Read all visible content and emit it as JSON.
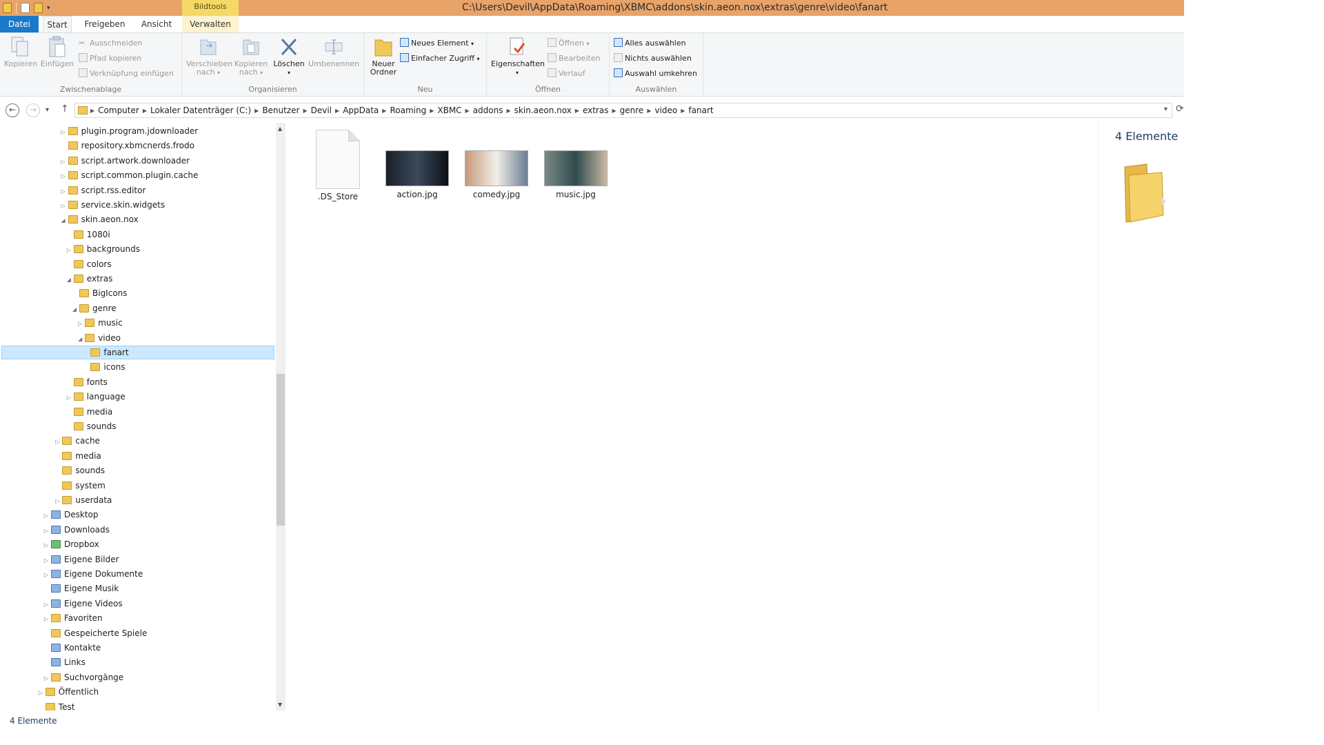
{
  "window": {
    "title": "C:\\Users\\Devil\\AppData\\Roaming\\XBMC\\addons\\skin.aeon.nox\\extras\\genre\\video\\fanart",
    "context_tab_label": "Bildtools"
  },
  "tabs": {
    "datei": "Datei",
    "start": "Start",
    "freigeben": "Freigeben",
    "ansicht": "Ansicht",
    "verwalten": "Verwalten"
  },
  "ribbon": {
    "zwischenablage": {
      "label": "Zwischenablage",
      "kopieren": "Kopieren",
      "einfuegen": "Einfügen",
      "ausschneiden": "Ausschneiden",
      "pfad_kopieren": "Pfad kopieren",
      "verknuepfung": "Verknüpfung einfügen"
    },
    "organisieren": {
      "label": "Organisieren",
      "verschieben_1": "Verschieben",
      "verschieben_2": "nach",
      "kopieren_1": "Kopieren",
      "kopieren_2": "nach",
      "loeschen": "Löschen",
      "umbenennen": "Umbenennen"
    },
    "neu": {
      "label": "Neu",
      "neuer_1": "Neuer",
      "neuer_2": "Ordner",
      "neues_element": "Neues Element",
      "einfacher_zugriff": "Einfacher Zugriff"
    },
    "oeffnen": {
      "label": "Öffnen",
      "eigenschaften": "Eigenschaften",
      "oeffnen": "Öffnen",
      "bearbeiten": "Bearbeiten",
      "verlauf": "Verlauf"
    },
    "auswaehlen": {
      "label": "Auswählen",
      "alles": "Alles auswählen",
      "nichts": "Nichts auswählen",
      "umkehren": "Auswahl umkehren"
    }
  },
  "breadcrumbs": [
    "Computer",
    "Lokaler Datenträger (C:)",
    "Benutzer",
    "Devil",
    "AppData",
    "Roaming",
    "XBMC",
    "addons",
    "skin.aeon.nox",
    "extras",
    "genre",
    "video",
    "fanart"
  ],
  "tree": [
    {
      "label": "plugin.program.jdownloader",
      "level": 3,
      "exp": "▷",
      "type": "folder"
    },
    {
      "label": "repository.xbmcnerds.frodo",
      "level": 3,
      "exp": "",
      "type": "folder"
    },
    {
      "label": "script.artwork.downloader",
      "level": 3,
      "exp": "▷",
      "type": "folder"
    },
    {
      "label": "script.common.plugin.cache",
      "level": 3,
      "exp": "▷",
      "type": "folder"
    },
    {
      "label": "script.rss.editor",
      "level": 3,
      "exp": "▷",
      "type": "folder"
    },
    {
      "label": "service.skin.widgets",
      "level": 3,
      "exp": "▷",
      "type": "folder"
    },
    {
      "label": "skin.aeon.nox",
      "level": 3,
      "exp": "◢",
      "type": "folder"
    },
    {
      "label": "1080i",
      "level": 4,
      "exp": "",
      "type": "folder"
    },
    {
      "label": "backgrounds",
      "level": 4,
      "exp": "▷",
      "type": "folder"
    },
    {
      "label": "colors",
      "level": 4,
      "exp": "",
      "type": "folder"
    },
    {
      "label": "extras",
      "level": 4,
      "exp": "◢",
      "type": "folder"
    },
    {
      "label": "BigIcons",
      "level": 5,
      "exp": "",
      "type": "folder"
    },
    {
      "label": "genre",
      "level": 5,
      "exp": "◢",
      "type": "folder"
    },
    {
      "label": "music",
      "level": 6,
      "exp": "▷",
      "type": "folder"
    },
    {
      "label": "video",
      "level": 6,
      "exp": "◢",
      "type": "folder"
    },
    {
      "label": "fanart",
      "level": 7,
      "exp": "",
      "type": "folder",
      "selected": true
    },
    {
      "label": "icons",
      "level": 7,
      "exp": "",
      "type": "folder"
    },
    {
      "label": "fonts",
      "level": 4,
      "exp": "",
      "type": "folder"
    },
    {
      "label": "language",
      "level": 4,
      "exp": "▷",
      "type": "folder"
    },
    {
      "label": "media",
      "level": 4,
      "exp": "",
      "type": "folder"
    },
    {
      "label": "sounds",
      "level": 4,
      "exp": "",
      "type": "folder"
    },
    {
      "label": "cache",
      "level": 2,
      "exp": "▷",
      "type": "folder"
    },
    {
      "label": "media",
      "level": 2,
      "exp": "",
      "type": "folder"
    },
    {
      "label": "sounds",
      "level": 2,
      "exp": "",
      "type": "folder"
    },
    {
      "label": "system",
      "level": 2,
      "exp": "",
      "type": "folder"
    },
    {
      "label": "userdata",
      "level": 2,
      "exp": "▷",
      "type": "folder"
    },
    {
      "label": "Desktop",
      "level": 0,
      "exp": "▷",
      "type": "lib"
    },
    {
      "label": "Downloads",
      "level": 0,
      "exp": "▷",
      "type": "lib"
    },
    {
      "label": "Dropbox",
      "level": 0,
      "exp": "▷",
      "type": "green"
    },
    {
      "label": "Eigene Bilder",
      "level": 0,
      "exp": "▷",
      "type": "lib"
    },
    {
      "label": "Eigene Dokumente",
      "level": 0,
      "exp": "▷",
      "type": "lib"
    },
    {
      "label": "Eigene Musik",
      "level": 0,
      "exp": "",
      "type": "lib"
    },
    {
      "label": "Eigene Videos",
      "level": 0,
      "exp": "▷",
      "type": "lib"
    },
    {
      "label": "Favoriten",
      "level": 0,
      "exp": "▷",
      "type": "folder"
    },
    {
      "label": "Gespeicherte Spiele",
      "level": 0,
      "exp": "",
      "type": "folder"
    },
    {
      "label": "Kontakte",
      "level": 0,
      "exp": "",
      "type": "lib"
    },
    {
      "label": "Links",
      "level": 0,
      "exp": "",
      "type": "lib"
    },
    {
      "label": "Suchvorgänge",
      "level": 0,
      "exp": "▷",
      "type": "folder"
    },
    {
      "label": "Öffentlich",
      "level": -1,
      "exp": "▷",
      "type": "folder"
    },
    {
      "label": "Test",
      "level": -1,
      "exp": "",
      "type": "folder"
    }
  ],
  "files": [
    {
      "name": ".DS_Store",
      "kind": "blank"
    },
    {
      "name": "action.jpg",
      "kind": "photo",
      "colors": [
        "#1a1e28",
        "#3b4a5c",
        "#0d0f14"
      ]
    },
    {
      "name": "comedy.jpg",
      "kind": "photo",
      "colors": [
        "#c79a7a",
        "#f2efe8",
        "#6a7d92"
      ]
    },
    {
      "name": "music.jpg",
      "kind": "photo",
      "colors": [
        "#7a8a86",
        "#2f4a4e",
        "#c9b9a4"
      ]
    }
  ],
  "details": {
    "count": "4 Elemente"
  },
  "status": {
    "count": "4 Elemente"
  },
  "colors": {
    "titlebar": "#e8a368",
    "accent": "#1979ca",
    "selection": "#cce8ff"
  }
}
